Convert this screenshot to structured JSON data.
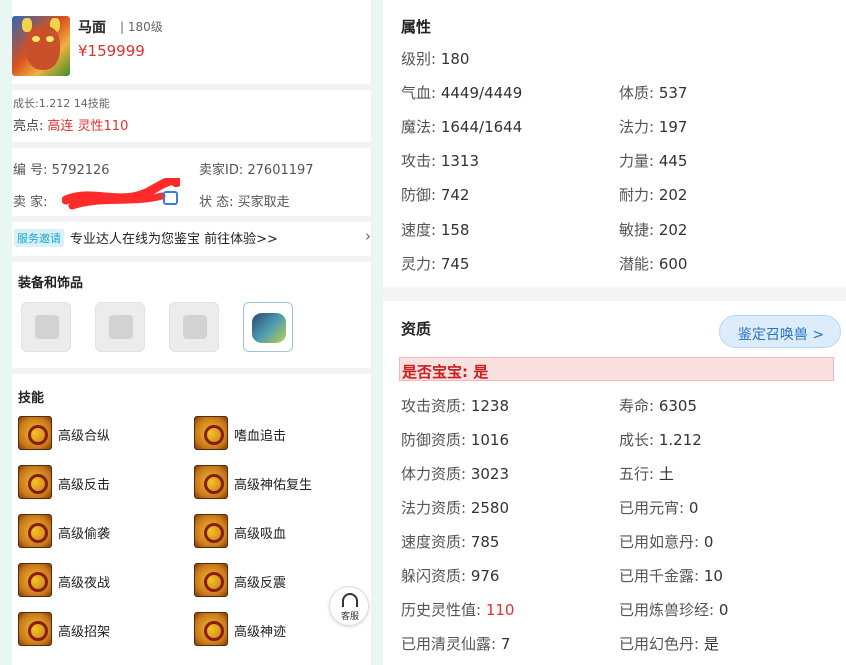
{
  "pet": {
    "name": "马面",
    "level": "| 180级",
    "price": "¥159999",
    "growth_skills": "成长:1.212 14技能",
    "highlight_label": "亮点:",
    "highlight_values": "高连 灵性110"
  },
  "meta": {
    "serial_label": "编 号:",
    "serial_value": "5792126",
    "seller_id_label": "卖家ID:",
    "seller_id_value": "27601197",
    "seller_label": "卖 家:",
    "status_label": "状 态:",
    "status_value": "买家取走"
  },
  "service": {
    "tag": "服务邀请",
    "text": "专业达人在线为您鉴宝 前往体验>>",
    "arrow": "›"
  },
  "equipment": {
    "title": "装备和饰品"
  },
  "skills": {
    "title": "技能",
    "left": [
      "高级合纵",
      "高级反击",
      "高级偷袭",
      "高级夜战",
      "高级招架"
    ],
    "right": [
      "嗜血追击",
      "高级神佑复生",
      "高级吸血",
      "高级反震",
      "高级神迹"
    ]
  },
  "customer_service": {
    "label": "客服"
  },
  "attributes": {
    "title": "属性",
    "level_label": "级别:",
    "level_value": "180",
    "rows": [
      {
        "k1": "气血:",
        "v1": "4449/4449",
        "k2": "体质:",
        "v2": "537"
      },
      {
        "k1": "魔法:",
        "v1": "1644/1644",
        "k2": "法力:",
        "v2": "197"
      },
      {
        "k1": "攻击:",
        "v1": "1313",
        "k2": "力量:",
        "v2": "445"
      },
      {
        "k1": "防御:",
        "v1": "742",
        "k2": "耐力:",
        "v2": "202"
      },
      {
        "k1": "速度:",
        "v1": "158",
        "k2": "敏捷:",
        "v2": "202"
      },
      {
        "k1": "灵力:",
        "v1": "745",
        "k2": "潜能:",
        "v2": "600"
      }
    ]
  },
  "aptitude": {
    "title": "资质",
    "check_button": "鉴定召唤兽 >",
    "baby": "是否宝宝: 是",
    "rows": [
      {
        "k1": "攻击资质:",
        "v1": "1238",
        "k2": "寿命:",
        "v2": "6305"
      },
      {
        "k1": "防御资质:",
        "v1": "1016",
        "k2": "成长:",
        "v2": "1.212"
      },
      {
        "k1": "体力资质:",
        "v1": "3023",
        "k2": "五行:",
        "v2": "土"
      },
      {
        "k1": "法力资质:",
        "v1": "2580",
        "k2": "已用元宵:",
        "v2": "0"
      },
      {
        "k1": "速度资质:",
        "v1": "785",
        "k2": "已用如意丹:",
        "v2": "0"
      },
      {
        "k1": "躲闪资质:",
        "v1": "976",
        "k2": "已用千金露:",
        "v2": "10"
      },
      {
        "k1": "历史灵性值:",
        "v1": "110",
        "k2": "已用炼兽珍经:",
        "v2": "0"
      },
      {
        "k1": "已用清灵仙露:",
        "v1": "7",
        "k2": "已用幻色丹:",
        "v2": "是"
      }
    ]
  },
  "colors": {
    "accent_red": "#e03030",
    "link_blue": "#2a73c0",
    "edge_mint": "#e9f7f3"
  }
}
